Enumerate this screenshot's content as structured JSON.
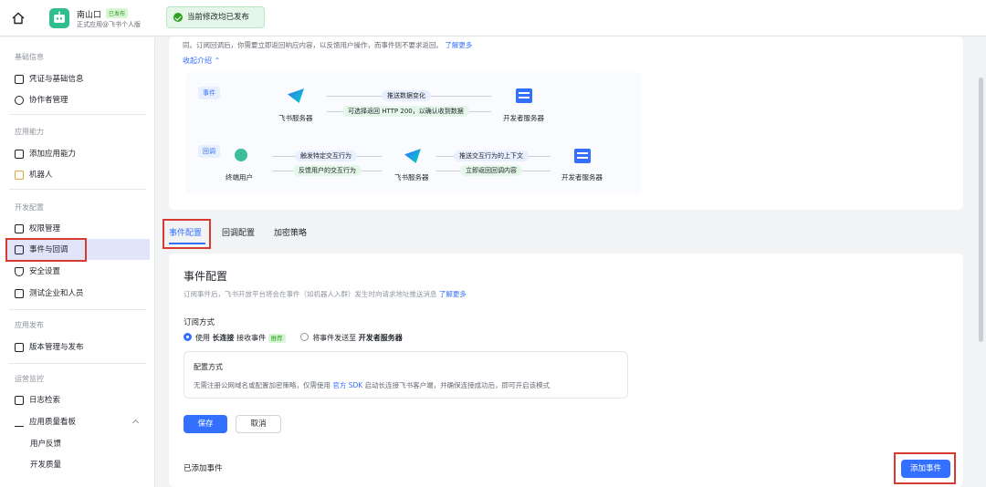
{
  "header": {
    "app_name": "南山口",
    "app_tag": "已发布",
    "app_subtitle": "正式应用@飞书个人版",
    "toast": "当前修改均已发布"
  },
  "sidebar": {
    "groups": [
      {
        "title": "基础信息",
        "items": [
          "凭证与基础信息",
          "协作者管理"
        ]
      },
      {
        "title": "应用能力",
        "items": [
          "添加应用能力",
          "机器人"
        ]
      },
      {
        "title": "开发配置",
        "items": [
          "权限管理",
          "事件与回调",
          "安全设置",
          "测试企业和人员"
        ]
      },
      {
        "title": "应用发布",
        "items": [
          "版本管理与发布"
        ]
      },
      {
        "title": "运营监控",
        "items": [
          "日志检索",
          "应用质量看板",
          "用户反馈",
          "开发质量"
        ]
      }
    ],
    "active_item": "事件与回调"
  },
  "intro": {
    "text": "同。订阅回调后，你需要立即返回响应内容，以反馈用户操作，而事件则不要求返回。",
    "learn_more": "了解更多",
    "collapse": "收起介绍"
  },
  "diagram": {
    "event_tag": "事件",
    "callback_tag": "回调",
    "feishu_server": "飞书服务器",
    "dev_server": "开发者服务器",
    "end_user": "终端用户",
    "push_change": "推送数据变化",
    "return_200": "可选择返回 HTTP 200，以确认收到数据",
    "trigger": "触发特定交互行为",
    "feedback": "反馈用户的交互行为",
    "push_context": "推送交互行为的上下文",
    "return_response": "立即返回回调内容"
  },
  "tabs": [
    "事件配置",
    "回调配置",
    "加密策略"
  ],
  "event_config": {
    "title": "事件配置",
    "desc": "订阅事件后，飞书开放平台将会在事件（如机器人入群）发生时向请求地址推送消息",
    "learn_more": "了解更多",
    "sub_title": "订阅方式",
    "option1_pre": "使用",
    "option1_bold": "长连接",
    "option1_post": "接收事件",
    "option1_tag": "推荐",
    "option2_pre": "将事件发送至",
    "option2_bold": "开发者服务器",
    "config_title": "配置方式",
    "config_text_pre": "无需注册公网域名或配置加密策略，仅需使用",
    "config_link": "官方 SDK",
    "config_text_post": "启动长连接飞书客户端，并确保连接成功后，即可开启该模式",
    "save": "保存",
    "cancel": "取消",
    "added_events": "已添加事件",
    "add_event": "添加事件"
  }
}
